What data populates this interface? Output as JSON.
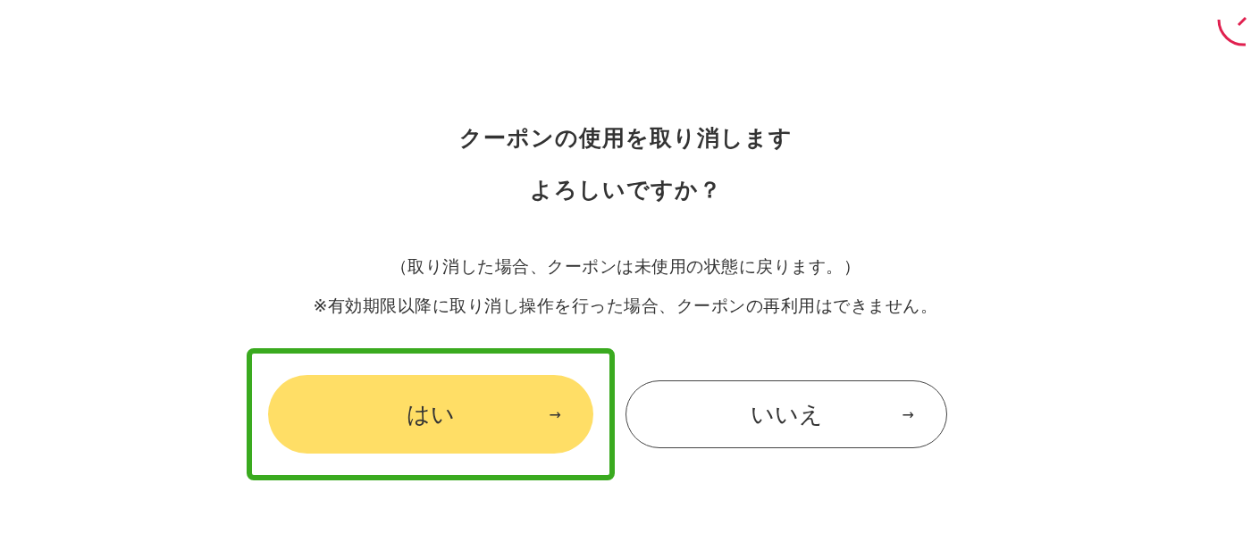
{
  "dialog": {
    "title_lines": [
      "クーポンの使用を取り消します",
      "よろしいですか？"
    ],
    "notes": [
      "（取り消した場合、クーポンは未使用の状態に戻ります。）",
      "※有効期限以降に取り消し操作を行った場合、クーポンの再利用はできません。"
    ],
    "buttons": [
      {
        "label": "はい",
        "arrow": "→",
        "kind": "primary",
        "selected": true
      },
      {
        "label": "いいえ",
        "arrow": "→",
        "kind": "secondary",
        "selected": false
      }
    ]
  }
}
